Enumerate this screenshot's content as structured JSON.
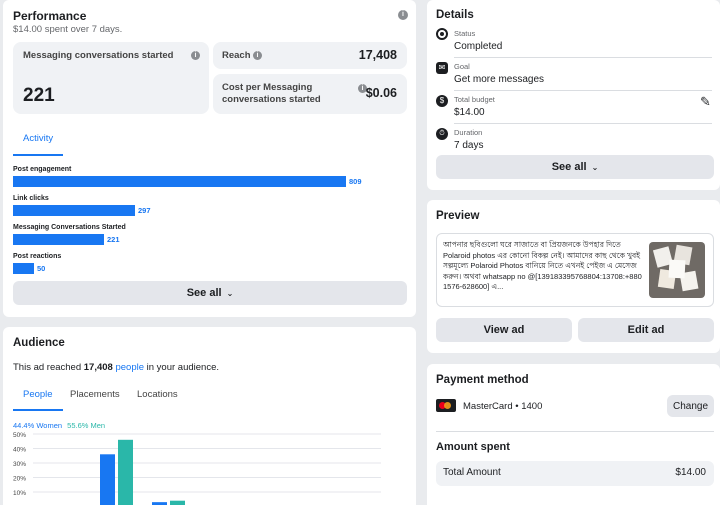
{
  "performance": {
    "title": "Performance",
    "subtitle": "$14.00 spent over 7 days.",
    "messaging_label": "Messaging conversations started",
    "messaging_value": "221",
    "reach_label": "Reach",
    "reach_value": "17,408",
    "cost_label": "Cost per Messaging conversations started",
    "cost_value": "$0.06",
    "activity_tab": "Activity",
    "bars": [
      {
        "label": "Post engagement",
        "value": 809
      },
      {
        "label": "Link clicks",
        "value": 297
      },
      {
        "label": "Messaging Conversations Started",
        "value": 221
      },
      {
        "label": "Post reactions",
        "value": 50
      }
    ],
    "bar_max": 809,
    "see_all": "See all"
  },
  "audience": {
    "title": "Audience",
    "reach_prefix": "This ad reached",
    "reach_number": "17,408",
    "reach_link": "people",
    "reach_suffix": "in your audience.",
    "tabs": [
      "People",
      "Placements",
      "Locations"
    ],
    "women_pct": "44.4% Women",
    "men_pct": "55.6% Men",
    "y_ticks": [
      "50%",
      "40%",
      "30%",
      "20%",
      "10%"
    ],
    "chart_data": {
      "type": "bar",
      "ylim": [
        0,
        50
      ],
      "series": [
        {
          "name": "Women",
          "values": [
            36,
            3
          ]
        },
        {
          "name": "Men",
          "values": [
            46,
            4
          ]
        }
      ],
      "colors": {
        "women": "#1877f2",
        "men": "#2ab7a9"
      }
    }
  },
  "details": {
    "title": "Details",
    "rows": [
      {
        "icon": "status-icon",
        "label": "Status",
        "value": "Completed"
      },
      {
        "icon": "goal-icon",
        "label": "Goal",
        "value": "Get more messages"
      },
      {
        "icon": "budget-icon",
        "label": "Total budget",
        "value": "$14.00"
      },
      {
        "icon": "duration-icon",
        "label": "Duration",
        "value": "7 days"
      }
    ],
    "see_all": "See all"
  },
  "preview": {
    "title": "Preview",
    "text": "আপনার ছবিগুলো ঘরে সাজাতে বা প্রিয়জনকে উপহার দিতে Polaroid photos এর কোনো বিকল্প নেই। আমাদের কাছ থেকে খুবই সল্পমূল্যে Polaroid Photos বানিয়ে নিতে এখনই পেইজ এ মেসেজ করুন। অথবা whatsapp no @[139183395768804:13708:+880 1576-628600] এ...",
    "view_ad": "View ad",
    "edit_ad": "Edit ad"
  },
  "payment": {
    "title": "Payment method",
    "card": "MasterCard • 1400",
    "change": "Change"
  },
  "amount": {
    "title": "Amount spent",
    "total_label": "Total Amount",
    "total_value": "$14.00"
  },
  "colors": {
    "accent": "#1877f2",
    "men": "#2ab7a9"
  }
}
